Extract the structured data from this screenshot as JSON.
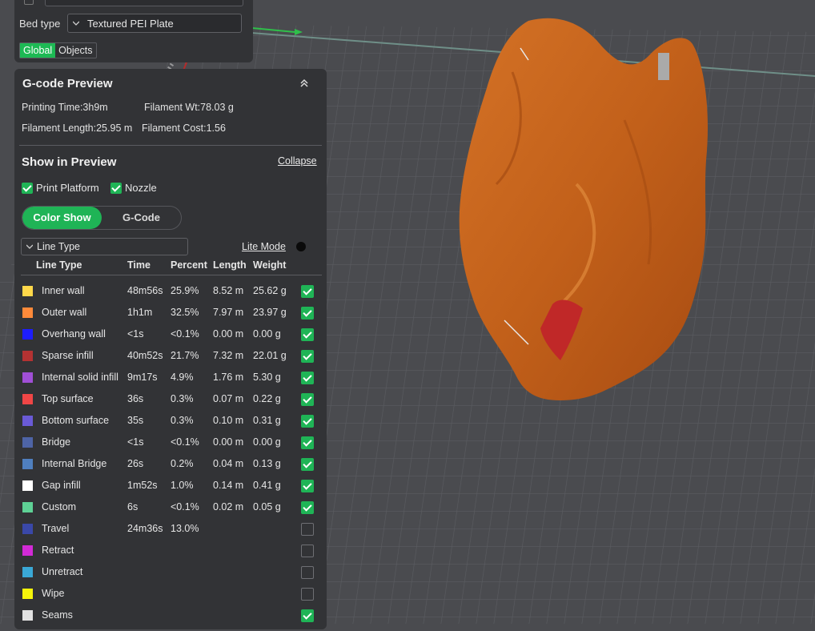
{
  "top": {
    "bed_type_label": "Bed type",
    "bed_type_value": "Textured PEI Plate",
    "tabs": [
      {
        "label": "Global",
        "active": true
      },
      {
        "label": "Objects",
        "active": false
      }
    ]
  },
  "gcode": {
    "title": "G-code Preview",
    "printing_time": "Printing Time:3h9m",
    "filament_wt": "Filament Wt:78.03 g",
    "filament_length": "Filament Length:25.95 m",
    "filament_cost": "Filament Cost:1.56"
  },
  "show": {
    "title": "Show in Preview",
    "collapse": "Collapse",
    "print_platform": "Print Platform",
    "nozzle": "Nozzle",
    "mode_color_show": "Color Show",
    "mode_gcode": "G-Code",
    "view_select": "Line Type",
    "lite_mode": "Lite Mode"
  },
  "table": {
    "headers": {
      "name": "Line Type",
      "time": "Time",
      "percent": "Percent",
      "length": "Length",
      "weight": "Weight"
    },
    "rows": [
      {
        "color": "#ffd84a",
        "name": "Inner wall",
        "time": "48m56s",
        "percent": "25.9%",
        "length": "8.52 m",
        "weight": "25.62 g",
        "checked": true
      },
      {
        "color": "#ff8a3a",
        "name": "Outer wall",
        "time": "1h1m",
        "percent": "32.5%",
        "length": "7.97 m",
        "weight": "23.97 g",
        "checked": true
      },
      {
        "color": "#1d1dff",
        "name": "Overhang wall",
        "time": "<1s",
        "percent": "<0.1%",
        "length": "0.00 m",
        "weight": "0.00 g",
        "checked": true
      },
      {
        "color": "#b43232",
        "name": "Sparse infill",
        "time": "40m52s",
        "percent": "21.7%",
        "length": "7.32 m",
        "weight": "22.01 g",
        "checked": true
      },
      {
        "color": "#a04fd6",
        "name": "Internal solid infill",
        "time": "9m17s",
        "percent": "4.9%",
        "length": "1.76 m",
        "weight": "5.30 g",
        "checked": true
      },
      {
        "color": "#f04646",
        "name": "Top surface",
        "time": "36s",
        "percent": "0.3%",
        "length": "0.07 m",
        "weight": "0.22 g",
        "checked": true
      },
      {
        "color": "#6a5ad6",
        "name": "Bottom surface",
        "time": "35s",
        "percent": "0.3%",
        "length": "0.10 m",
        "weight": "0.31 g",
        "checked": true
      },
      {
        "color": "#4e64a6",
        "name": "Bridge",
        "time": "<1s",
        "percent": "<0.1%",
        "length": "0.00 m",
        "weight": "0.00 g",
        "checked": true
      },
      {
        "color": "#4f7fbf",
        "name": "Internal Bridge",
        "time": "26s",
        "percent": "0.2%",
        "length": "0.04 m",
        "weight": "0.13 g",
        "checked": true
      },
      {
        "color": "#ffffff",
        "name": "Gap infill",
        "time": "1m52s",
        "percent": "1.0%",
        "length": "0.14 m",
        "weight": "0.41 g",
        "checked": true
      },
      {
        "color": "#5ed195",
        "name": "Custom",
        "time": "6s",
        "percent": "<0.1%",
        "length": "0.02 m",
        "weight": "0.05 g",
        "checked": true
      },
      {
        "color": "#3a48a8",
        "name": "Travel",
        "time": "24m36s",
        "percent": "13.0%",
        "length": "",
        "weight": "",
        "checked": false
      },
      {
        "color": "#d22ad6",
        "name": "Retract",
        "time": "",
        "percent": "",
        "length": "",
        "weight": "",
        "checked": false
      },
      {
        "color": "#3aa8d6",
        "name": "Unretract",
        "time": "",
        "percent": "",
        "length": "",
        "weight": "",
        "checked": false
      },
      {
        "color": "#f5f50a",
        "name": "Wipe",
        "time": "",
        "percent": "",
        "length": "",
        "weight": "",
        "checked": false
      },
      {
        "color": "#e2e2e2",
        "name": "Seams",
        "time": "",
        "percent": "",
        "length": "",
        "weight": "",
        "checked": true
      }
    ]
  },
  "colors": {
    "accent": "#1fb456",
    "model": "#c8621a",
    "panel": "#323336",
    "viewport": "#4a4b4f"
  }
}
